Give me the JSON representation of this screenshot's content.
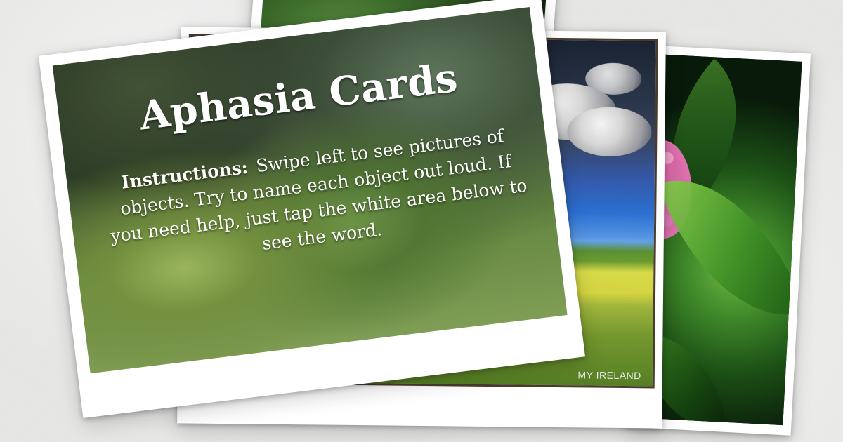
{
  "front_card": {
    "title": "Aphasia Cards",
    "instructions_label": "Instructions:",
    "instructions_text": "Swipe left to see pictures of objects. Try to name each object out loud. If you need help, just tap the white area below to see the word."
  },
  "landscape_card": {
    "watermark": "MY IRELAND"
  },
  "icons": {
    "cloud_icon": "cloud-icon",
    "flower_icon": "flower-icon",
    "leaf_icon": "leaf-icon"
  },
  "colors": {
    "page_background": "#e7e7e6",
    "card_white": "#ffffff",
    "text_white": "#ffffff",
    "accent_pink": "#d96aa9",
    "accent_green": "#6b9b30",
    "accent_blue": "#2b70d1"
  }
}
